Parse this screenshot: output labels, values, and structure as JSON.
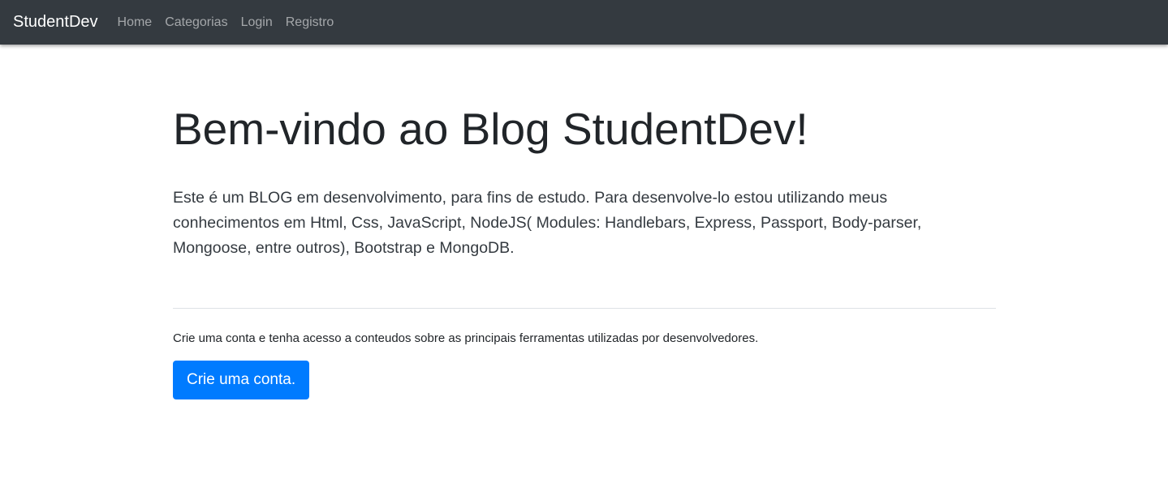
{
  "navbar": {
    "brand": "StudentDev",
    "links": [
      {
        "label": "Home"
      },
      {
        "label": "Categorias"
      },
      {
        "label": "Login"
      },
      {
        "label": "Registro"
      }
    ],
    "background_color": "#343a40"
  },
  "jumbotron": {
    "title": "Bem-vindo ao Blog StudentDev!",
    "lead": "Este é um BLOG em desenvolvimento, para fins de estudo. Para desenvolve-lo estou utilizando meus conhecimentos em Html, Css, JavaScript, NodeJS( Modules: Handlebars, Express, Passport, Body-parser, Mongoose, entre outros), Bootstrap e MongoDB.",
    "cta_text": "Crie uma conta e tenha acesso a conteudos sobre as principais ferramentas utilizadas por desenvolvedores.",
    "cta_button": "Crie uma conta.",
    "accent_color": "#007bff"
  }
}
